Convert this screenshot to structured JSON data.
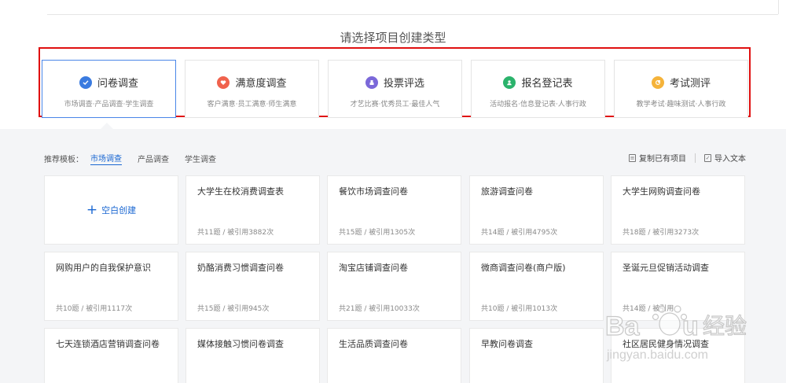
{
  "page_title": "请选择项目创建类型",
  "types": [
    {
      "title": "问卷调查",
      "desc": "市场调查·产品调查·学生调查",
      "color": "#3a7be0",
      "icon": "check-icon"
    },
    {
      "title": "满意度调查",
      "desc": "客户满意·员工满意·师生满意",
      "color": "#f0624d",
      "icon": "heart-icon"
    },
    {
      "title": "投票评选",
      "desc": "才艺比赛·优秀员工·最佳人气",
      "color": "#7b68d9",
      "icon": "vote-icon"
    },
    {
      "title": "报名登记表",
      "desc": "活动报名·信息登记表·人事行政",
      "color": "#2bb36c",
      "icon": "person-icon"
    },
    {
      "title": "考试测评",
      "desc": "教学考试·趣味测试·人事行政",
      "color": "#f5b33a",
      "icon": "exam-icon"
    }
  ],
  "filters": {
    "label": "推荐模板：",
    "items": [
      "市场调查",
      "产品调查",
      "学生调查"
    ]
  },
  "actions": {
    "copy": "复制已有项目",
    "import": "导入文本"
  },
  "blank_card": {
    "label": "空白创建"
  },
  "templates": [
    {
      "title": "大学生在校消费调查表",
      "meta": "共11题 / 被引用3882次"
    },
    {
      "title": "餐饮市场调查问卷",
      "meta": "共15题 / 被引用1305次"
    },
    {
      "title": "旅游调查问卷",
      "meta": "共14题 / 被引用4795次"
    },
    {
      "title": "大学生网购调查问卷",
      "meta": "共18题 / 被引用3273次"
    },
    {
      "title": "网购用户的自我保护意识",
      "meta": "共10题 / 被引用1117次"
    },
    {
      "title": "奶酪消费习惯调查问卷",
      "meta": "共15题 / 被引用945次"
    },
    {
      "title": "淘宝店铺调查问卷",
      "meta": "共21题 / 被引用10033次"
    },
    {
      "title": "微商调查问卷(商户版)",
      "meta": "共10题 / 被引用1013次"
    },
    {
      "title": "圣诞元旦促销活动调查",
      "meta": "共14题 / 被引用"
    },
    {
      "title": "七天连锁酒店营销调查问卷",
      "meta": ""
    },
    {
      "title": "媒体接触习惯问卷调查",
      "meta": ""
    },
    {
      "title": "生活品质调查问卷",
      "meta": ""
    },
    {
      "title": "早教问卷调查",
      "meta": ""
    },
    {
      "title": "社区居民健身情况调查",
      "meta": ""
    }
  ],
  "watermark": {
    "brand": "Baidu 经验",
    "url": "jingyan.baidu.com"
  }
}
